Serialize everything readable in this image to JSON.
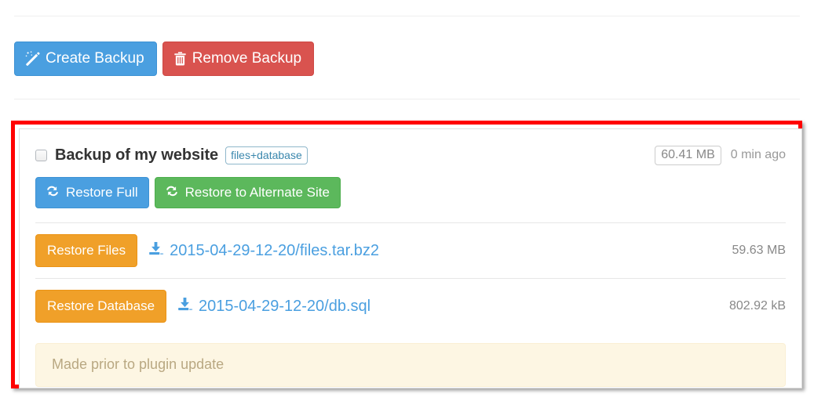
{
  "toolbar": {
    "create_backup_label": "Create Backup",
    "remove_backup_label": "Remove Backup",
    "create_icon": "magic-wand-icon",
    "remove_icon": "trash-icon"
  },
  "backup": {
    "title": "Backup of my website",
    "type_badge": "files+database",
    "total_size": "60.41 MB",
    "time_ago": "0 min ago",
    "checkbox_checked": false,
    "actions": [
      {
        "label": "Restore Full",
        "icon": "refresh-icon",
        "style": "info"
      },
      {
        "label": "Restore to Alternate Site",
        "icon": "refresh-icon",
        "style": "success"
      }
    ],
    "files": [
      {
        "button_label": "Restore Files",
        "link_text": "2015-04-29-12-20/files.tar.bz2",
        "size": "59.63 MB",
        "icon": "download-icon"
      },
      {
        "button_label": "Restore Database",
        "link_text": "2015-04-29-12-20/db.sql",
        "size": "802.92 kB",
        "icon": "download-icon"
      }
    ],
    "note": "Made prior to plugin update"
  },
  "colors": {
    "primary": "#4a9fe0",
    "danger": "#d9534f",
    "success": "#5cb85c",
    "warning": "#f0a029",
    "annotation": "#ff0000",
    "note_bg": "#fdf6e3"
  }
}
